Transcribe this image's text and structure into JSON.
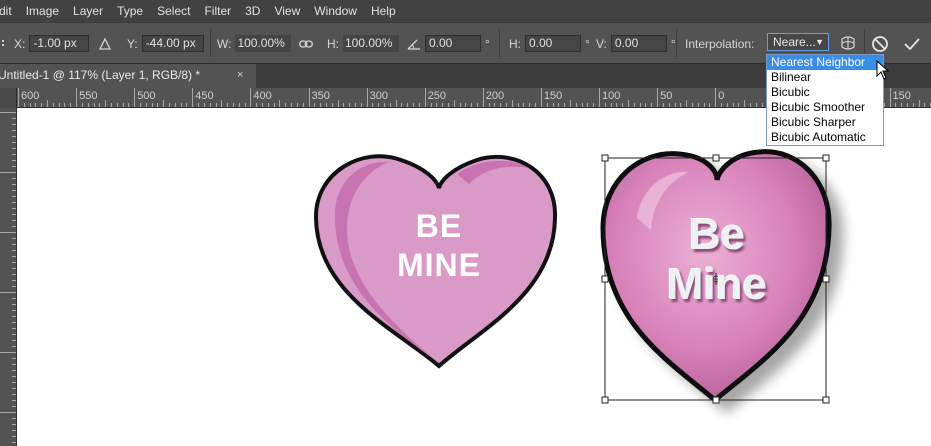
{
  "menu": [
    "dit",
    "Image",
    "Layer",
    "Type",
    "Select",
    "Filter",
    "3D",
    "View",
    "Window",
    "Help"
  ],
  "options": {
    "x_label": "X:",
    "x_value": "-1.00 px",
    "y_label": "Y:",
    "y_value": "-44.00 px",
    "w_label": "W:",
    "w_value": "100.00%",
    "h_label": "H:",
    "h_value": "100.00%",
    "angle_value": "0.00",
    "angle_unit": "°",
    "hskew_label": "H:",
    "hskew_value": "0.00",
    "hskew_unit": "°",
    "vskew_label": "V:",
    "vskew_value": "0.00",
    "vskew_unit": "°",
    "interp_label": "Interpolation:",
    "interp_value": "Neare...",
    "interp_options": [
      "Nearest Neighbor",
      "Bilinear",
      "Bicubic",
      "Bicubic Smoother",
      "Bicubic Sharper",
      "Bicubic Automatic"
    ],
    "interp_selected_index": 0
  },
  "doc_tab": {
    "title": "Untitled-1 @ 117% (Layer 1, RGB/8) *",
    "close": "×"
  },
  "ruler_labels": [
    "600",
    "550",
    "500",
    "450",
    "400",
    "350",
    "300",
    "250",
    "200",
    "150",
    "100",
    "50",
    "0",
    "50",
    "100",
    "150"
  ],
  "canvas": {
    "heart_left": {
      "line1": "BE",
      "line2": "MINE",
      "color": "#d99ac7"
    },
    "heart_right": {
      "line1": "Be",
      "line2": "Mine",
      "color": "#d882b9"
    }
  },
  "colors": {
    "accent": "#3b8de4",
    "ui_bg": "#535353",
    "menu_bg": "#424242"
  }
}
